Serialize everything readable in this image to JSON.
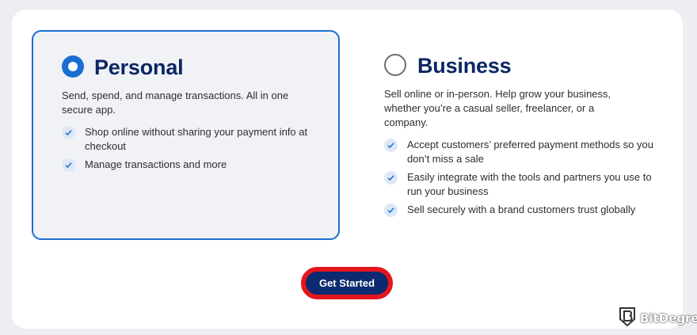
{
  "personal": {
    "title": "Personal",
    "selected": true,
    "description": "Send, spend, and manage transactions. All in one secure app.",
    "features": [
      "Shop online without sharing your payment info at checkout",
      "Manage transactions and more"
    ]
  },
  "business": {
    "title": "Business",
    "selected": false,
    "description": "Sell online or in-person. Help grow your business, whether you’re a casual seller, freelancer, or a company.",
    "features": [
      "Accept customers’ preferred payment methods so you don’t miss a sale",
      "Easily integrate with the tools and partners you use to run your business",
      "Sell securely with a brand customers trust globally"
    ]
  },
  "cta": {
    "label": "Get Started"
  },
  "watermark": {
    "text": "BitDegree",
    "icon": "bitdegree-shield-logo"
  },
  "colors": {
    "accent": "#1a6ed0",
    "title": "#0b2664",
    "button": "#0b2a6f",
    "highlight": "#e4161d"
  }
}
